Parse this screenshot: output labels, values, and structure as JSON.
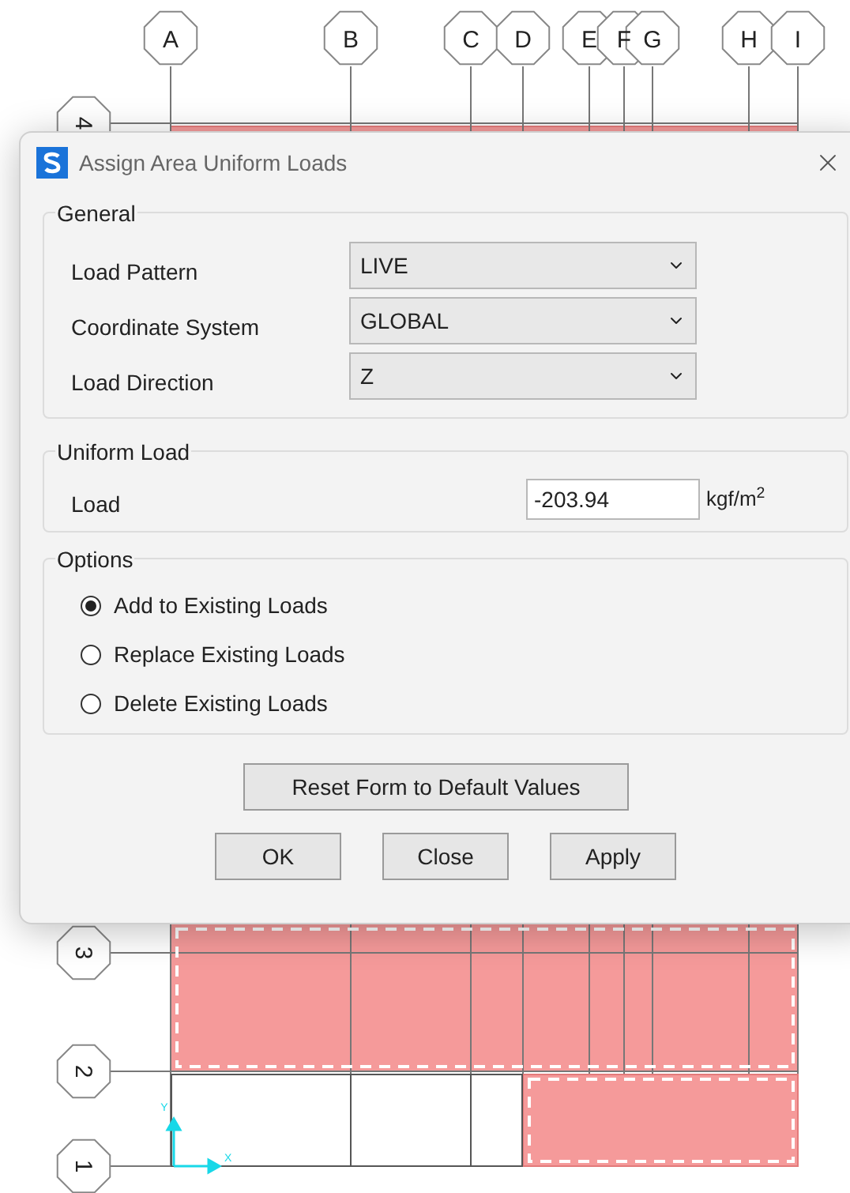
{
  "grid_columns": [
    {
      "label": "A"
    },
    {
      "label": "B"
    },
    {
      "label": "C"
    },
    {
      "label": "D"
    },
    {
      "label": "E"
    },
    {
      "label": "F"
    },
    {
      "label": "G"
    },
    {
      "label": "H"
    },
    {
      "label": "I"
    }
  ],
  "grid_rows": [
    {
      "label": "4"
    },
    {
      "label": "3"
    },
    {
      "label": "2"
    },
    {
      "label": "1"
    }
  ],
  "axes": {
    "x": "X",
    "y": "Y"
  },
  "dialog": {
    "title": "Assign Area Uniform Loads",
    "general": {
      "title": "General",
      "fields": [
        {
          "label": "Load Pattern",
          "value": "LIVE"
        },
        {
          "label": "Coordinate System",
          "value": "GLOBAL"
        },
        {
          "label": "Load Direction",
          "value": "Z"
        }
      ]
    },
    "uniform_load": {
      "title": "Uniform Load",
      "label": "Load",
      "value": "-203.94",
      "unit": "kgf/m$^{2}$"
    },
    "options": {
      "title": "Options",
      "items": [
        {
          "label": "Add to Existing Loads",
          "selected": true
        },
        {
          "label": "Replace Existing Loads",
          "selected": false
        },
        {
          "label": "Delete Existing Loads",
          "selected": false
        }
      ]
    },
    "reset_button": "Reset Form to Default Values",
    "buttons": [
      "OK",
      "Close",
      "Apply"
    ]
  }
}
